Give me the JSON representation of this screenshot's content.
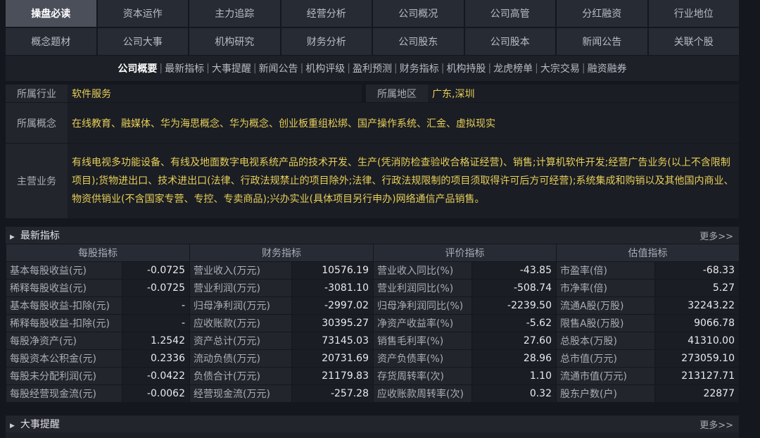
{
  "nav": {
    "row1": [
      "操盘必读",
      "资本运作",
      "主力追踪",
      "经营分析",
      "公司概况",
      "公司高管",
      "分红融资",
      "行业地位"
    ],
    "row2": [
      "概念题材",
      "公司大事",
      "机构研究",
      "财务分析",
      "公司股东",
      "公司股本",
      "新闻公告",
      "关联个股"
    ],
    "active": "操盘必读"
  },
  "subtabs": [
    "公司概要",
    "最新指标",
    "大事提醒",
    "新闻公告",
    "机构评级",
    "盈利预测",
    "财务指标",
    "机构持股",
    "龙虎榜单",
    "大宗交易",
    "融资融券"
  ],
  "profile": {
    "industry_label": "所属行业",
    "industry": "软件服务",
    "region_label": "所属地区",
    "region": "广东,深圳",
    "concept_label": "所属概念",
    "concept": "在线教育、融媒体、华为海思概念、华为概念、创业板重组松绑、国产操作系统、汇金、虚拟现实",
    "business_label": "主营业务",
    "business": "有线电视多功能设备、有线及地面数字电视系统产品的技术开发、生产(凭消防检查验收合格证经营)、销售;计算机软件开发;经营广告业务(以上不含限制项目);货物进出口、技术进出口(法律、行政法规禁止的项目除外;法律、行政法规限制的项目须取得许可后方可经营);系统集成和购销以及其他国内商业、物资供销业(不含国家专营、专控、专卖商品);兴办实业(具体项目另行申办)网络通信产品销售。"
  },
  "indicators": {
    "title": "最新指标",
    "more": "更多>>",
    "headers": [
      "每股指标",
      "财务指标",
      "评价指标",
      "估值指标"
    ],
    "rows": [
      [
        "基本每股收益(元)",
        "-0.0725",
        "营业收入(万元)",
        "10576.19",
        "营业收入同比(%)",
        "-43.85",
        "市盈率(倍)",
        "-68.33"
      ],
      [
        "稀释每股收益(元)",
        "-0.0725",
        "营业利润(万元)",
        "-3081.10",
        "营业利润同比(%)",
        "-508.74",
        "市净率(倍)",
        "5.27"
      ],
      [
        "基本每股收益-扣除(元)",
        "-",
        "归母净利润(万元)",
        "-2997.02",
        "归母净利润同比(%)",
        "-2239.50",
        "流通A股(万股)",
        "32243.22"
      ],
      [
        "稀释每股收益-扣除(元)",
        "-",
        "应收账款(万元)",
        "30395.27",
        "净资产收益率(%)",
        "-5.62",
        "限售A股(万股)",
        "9066.78"
      ],
      [
        "每股净资产(元)",
        "1.2542",
        "资产总计(万元)",
        "73145.03",
        "销售毛利率(%)",
        "27.60",
        "总股本(万股)",
        "41310.00"
      ],
      [
        "每股资本公积金(元)",
        "0.2336",
        "流动负债(万元)",
        "20731.69",
        "资产负债率(%)",
        "28.96",
        "总市值(万元)",
        "273059.10"
      ],
      [
        "每股未分配利润(元)",
        "-0.0422",
        "负债合计(万元)",
        "21179.83",
        "存货周转率(次)",
        "1.10",
        "流通市值(万元)",
        "213127.71"
      ],
      [
        "每股经营现金流(元)",
        "-0.0062",
        "经营现金流(万元)",
        "-257.28",
        "应收账款周转率(次)",
        "0.32",
        "股东户数(户)",
        "22877"
      ]
    ]
  },
  "events": {
    "title": "大事提醒",
    "more": "更多>>"
  }
}
